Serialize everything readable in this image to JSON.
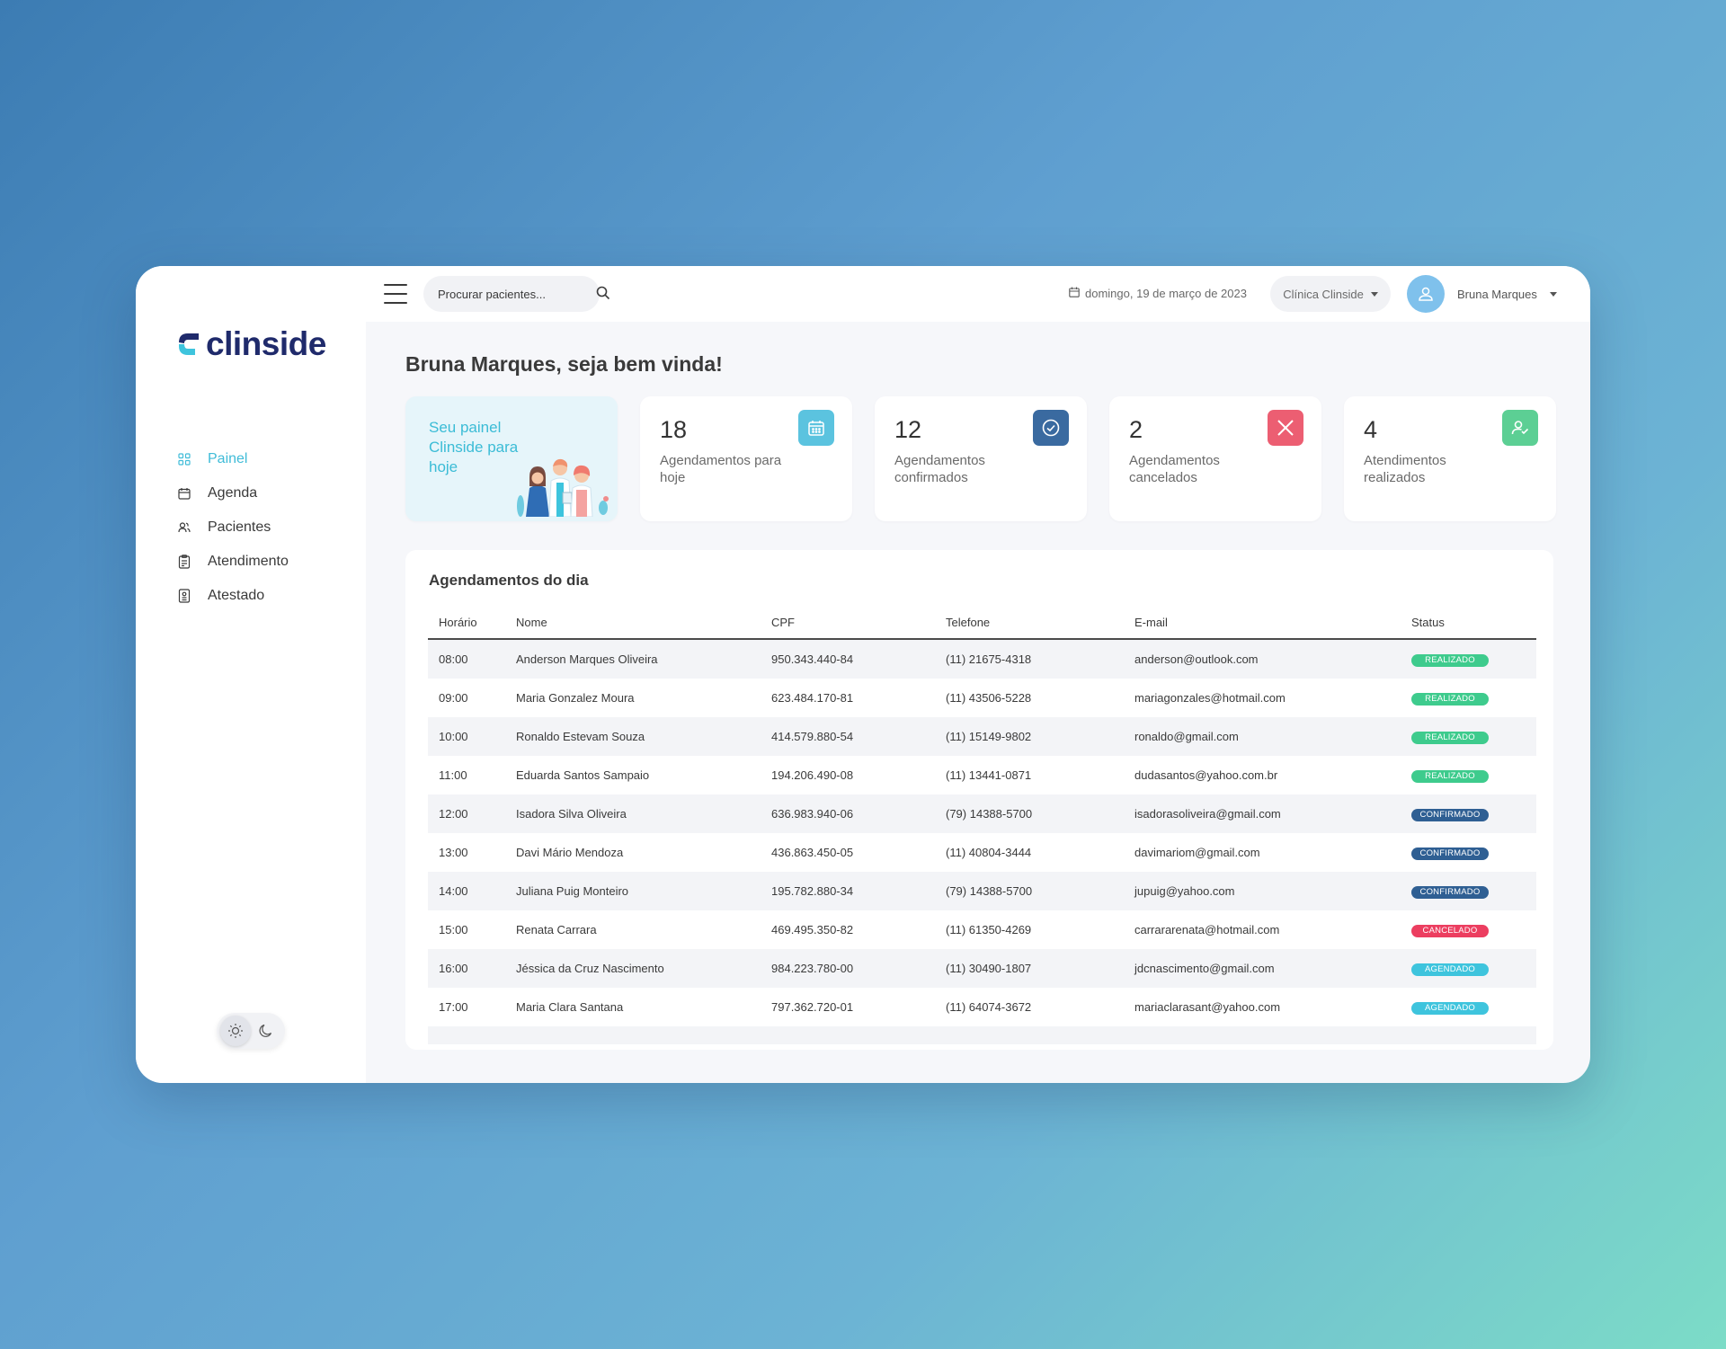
{
  "brand": {
    "name": "clinside"
  },
  "sidebar": {
    "items": [
      {
        "label": "Painel",
        "icon": "grid-icon",
        "active": true
      },
      {
        "label": "Agenda",
        "icon": "calendar-icon",
        "active": false
      },
      {
        "label": "Pacientes",
        "icon": "users-icon",
        "active": false
      },
      {
        "label": "Atendimento",
        "icon": "clipboard-icon",
        "active": false
      },
      {
        "label": "Atestado",
        "icon": "document-icon",
        "active": false
      }
    ]
  },
  "topbar": {
    "search_placeholder": "Procurar pacientes...",
    "date": "domingo, 19 de março de 2023",
    "clinic": "Clínica Clinside",
    "user": "Bruna Marques"
  },
  "welcome": "Bruna Marques, seja bem vinda!",
  "hero": {
    "text": "Seu painel Clinside para hoje"
  },
  "stats": [
    {
      "value": "18",
      "label": "Agendamentos para hoje",
      "icon": "calendar-icon",
      "color": "#5bc3df"
    },
    {
      "value": "12",
      "label": "Agendamentos confirmados",
      "icon": "check-circle-icon",
      "color": "#3a6aa0"
    },
    {
      "value": "2",
      "label": "Agendamentos cancelados",
      "icon": "close-icon",
      "color": "#ec5e72"
    },
    {
      "value": "4",
      "label": "Atendimentos realizados",
      "icon": "user-check-icon",
      "color": "#5ccf94"
    }
  ],
  "table": {
    "title": "Agendamentos do dia",
    "headers": [
      "Horário",
      "Nome",
      "CPF",
      "Telefone",
      "E-mail",
      "Status"
    ],
    "status_colors": {
      "REALIZADO": "#3ecb8d",
      "CONFIRMADO": "#2f5f93",
      "CANCELADO": "#ec3e60",
      "AGENDADO": "#3ec4dd"
    },
    "rows": [
      {
        "time": "08:00",
        "name": "Anderson Marques Oliveira",
        "cpf": "950.343.440-84",
        "phone": "(11) 21675-4318",
        "email": "anderson@outlook.com",
        "status": "REALIZADO"
      },
      {
        "time": "09:00",
        "name": "Maria Gonzalez Moura",
        "cpf": "623.484.170-81",
        "phone": "(11) 43506-5228",
        "email": "mariagonzales@hotmail.com",
        "status": "REALIZADO"
      },
      {
        "time": "10:00",
        "name": "Ronaldo Estevam Souza",
        "cpf": "414.579.880-54",
        "phone": "(11) 15149-9802",
        "email": "ronaldo@gmail.com",
        "status": "REALIZADO"
      },
      {
        "time": "11:00",
        "name": "Eduarda Santos Sampaio",
        "cpf": "194.206.490-08",
        "phone": "(11) 13441-0871",
        "email": "dudasantos@yahoo.com.br",
        "status": "REALIZADO"
      },
      {
        "time": "12:00",
        "name": "Isadora Silva Oliveira",
        "cpf": "636.983.940-06",
        "phone": "(79) 14388-5700",
        "email": "isadorasoliveira@gmail.com",
        "status": "CONFIRMADO"
      },
      {
        "time": "13:00",
        "name": "Davi Mário Mendoza",
        "cpf": "436.863.450-05",
        "phone": "(11) 40804-3444",
        "email": "davimariom@gmail.com",
        "status": "CONFIRMADO"
      },
      {
        "time": "14:00",
        "name": "Juliana Puig Monteiro",
        "cpf": "195.782.880-34",
        "phone": "(79) 14388-5700",
        "email": "jupuig@yahoo.com",
        "status": "CONFIRMADO"
      },
      {
        "time": "15:00",
        "name": "Renata Carrara",
        "cpf": "469.495.350-82",
        "phone": "(11) 61350-4269",
        "email": "carrararenata@hotmail.com",
        "status": "CANCELADO"
      },
      {
        "time": "16:00",
        "name": "Jéssica da Cruz Nascimento",
        "cpf": "984.223.780-00",
        "phone": "(11) 30490-1807",
        "email": "jdcnascimento@gmail.com",
        "status": "AGENDADO"
      },
      {
        "time": "17:00",
        "name": "Maria Clara Santana",
        "cpf": "797.362.720-01",
        "phone": "(11) 64074-3672",
        "email": "mariaclarasant@yahoo.com",
        "status": "AGENDADO"
      }
    ]
  }
}
